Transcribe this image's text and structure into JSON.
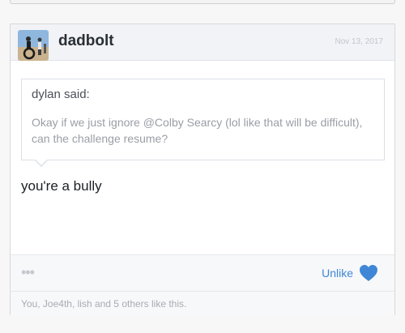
{
  "post": {
    "username": "dadbolt",
    "date": "Nov 13, 2017",
    "quote": {
      "author": "dylan said:",
      "text": "Okay if we just ignore @Colby Searcy (lol like that will be difficult), can the challenge resume?"
    },
    "message": "you're a bully",
    "footer": {
      "more_icon": "•••",
      "unlike_label": "Unlike",
      "heart_icon": "heart-icon",
      "likes_summary": "You, Joe4th, lish and 5 others like this."
    }
  },
  "colors": {
    "accent": "#3f87d6",
    "username": "#2a2f36",
    "muted": "#a7abb2"
  }
}
